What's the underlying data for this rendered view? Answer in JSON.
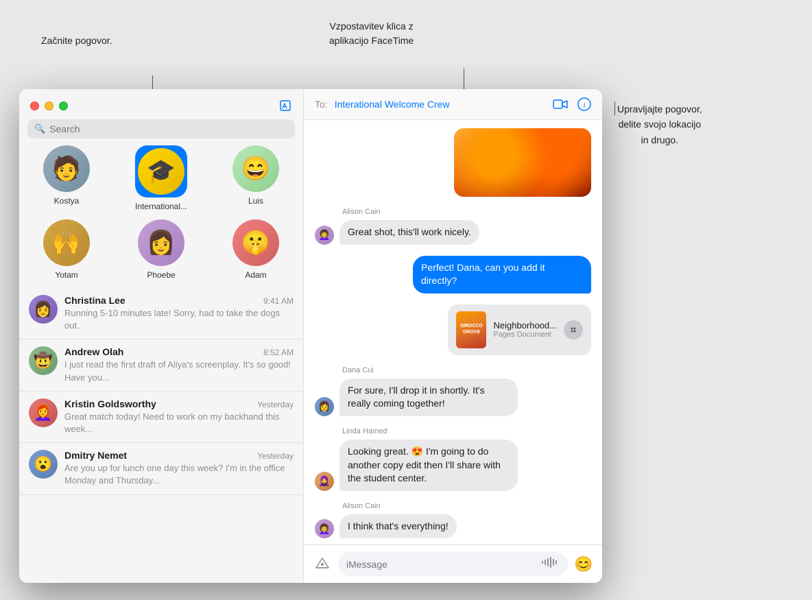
{
  "annotations": {
    "start_conversation": "Začnite pogovor.",
    "facetime_call": "Vzpostavitev klica z\naplikacijo FaceTime",
    "manage_conversation": "Upravljajte pogovor,\ndelite svojo lokacijo\nin drugo."
  },
  "sidebar": {
    "search_placeholder": "Search",
    "compose_icon": "✏",
    "pinned": [
      {
        "name": "Kostya",
        "emoji": "🧢",
        "bg": "#b0c4de",
        "selected": false
      },
      {
        "name": "International...",
        "emoji": "🎓",
        "bg": "#ffd700",
        "selected": true
      },
      {
        "name": "Luis",
        "emoji": "😄",
        "bg": "#c8f0c8",
        "selected": false
      },
      {
        "name": "Yotam",
        "emoji": "🙌",
        "bg": "#d4a843",
        "selected": false
      },
      {
        "name": "Phoebe",
        "emoji": "💁‍♀️",
        "bg": "#c4a0d4",
        "selected": false
      },
      {
        "name": "Adam",
        "emoji": "🤫",
        "bg": "#f08080",
        "selected": false
      }
    ],
    "contacts": [
      {
        "name": "Christina Lee",
        "time": "9:41 AM",
        "preview": "Running 5-10 minutes late! Sorry, had to take the dogs out.",
        "emoji": "👩",
        "bg": "#9b7fd4"
      },
      {
        "name": "Andrew Olah",
        "time": "8:52 AM",
        "preview": "I just read the first draft of Aliya's screenplay. It's so good! Have you...",
        "emoji": "🤠",
        "bg": "#8fbc8f"
      },
      {
        "name": "Kristin Goldsworthy",
        "time": "Yesterday",
        "preview": "Great match today! Need to work on my backhand this week...",
        "emoji": "👩‍🦰",
        "bg": "#e87a7a"
      },
      {
        "name": "Dmitry Nemet",
        "time": "Yesterday",
        "preview": "Are you up for lunch one day this week? I'm in the office Monday and Thursday...",
        "emoji": "😮",
        "bg": "#7a9ed4"
      }
    ]
  },
  "chat": {
    "to_label": "To:",
    "recipient": "Interational Welcome Crew",
    "video_icon": "📹",
    "info_icon": "ⓘ",
    "messages": [
      {
        "type": "image",
        "sender": "",
        "sent": true
      },
      {
        "type": "text",
        "sender": "Alison Cain",
        "text": "Great shot, this'll work nicely.",
        "sent": false,
        "avatar_emoji": "👩‍🦱",
        "avatar_bg": "#c4a0d4"
      },
      {
        "type": "text",
        "sender": "",
        "text": "Perfect! Dana, can you add it directly?",
        "sent": true
      },
      {
        "type": "doc",
        "sender": "",
        "doc_name": "Neighborhood...",
        "doc_type": "Pages Document",
        "sent": true
      },
      {
        "type": "text",
        "sender": "Dana Cui",
        "text": "For sure, I'll drop it in shortly. It's really coming together!",
        "sent": false,
        "avatar_emoji": "👩",
        "avatar_bg": "#7a9ed4"
      },
      {
        "type": "text",
        "sender": "Linda Hamed",
        "text": "Looking great. 😍 I'm going to do another copy edit then I'll share with the student center.",
        "sent": false,
        "avatar_emoji": "🧕",
        "avatar_bg": "#e8a870"
      },
      {
        "type": "text",
        "sender": "Alison Cain",
        "text": "I think that's everything!",
        "sent": false,
        "avatar_emoji": "👩‍🦱",
        "avatar_bg": "#c4a0d4"
      }
    ],
    "input_placeholder": "iMessage",
    "app_store_icon": "🅐",
    "emoji_icon": "😊"
  }
}
